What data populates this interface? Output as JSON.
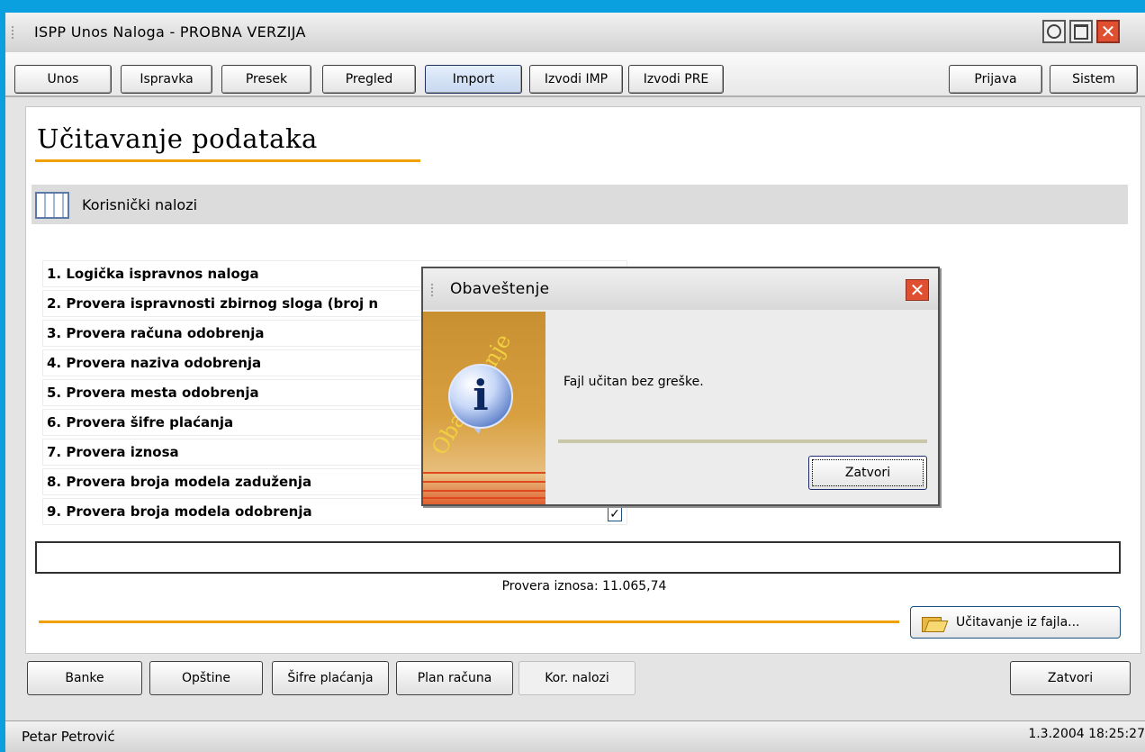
{
  "window": {
    "title": "ISPP Unos Naloga - PROBNA VERZIJA"
  },
  "toolbar": {
    "buttons": [
      "Unos",
      "Ispravka",
      "Presek",
      "Pregled",
      "Import",
      "Izvodi IMP",
      "Izvodi PRE"
    ],
    "right_buttons": [
      "Prijava",
      "Sistem"
    ],
    "active": "Import"
  },
  "page": {
    "title": "Učitavanje podataka",
    "section_title": "Korisnički nalozi",
    "checks": [
      "1. Logička ispravnos naloga",
      "2. Provera ispravnosti zbirnog sloga (broj n",
      "3. Provera računa odobrenja",
      "4. Provera naziva odobrenja",
      "5. Provera mesta odobrenja",
      "6. Provera šifre plaćanja",
      "7. Provera iznosa",
      "8. Provera broja modela zaduženja",
      "9. Provera broja modela odobrenja"
    ],
    "check_mark": "✓",
    "provera_iznosa": "Provera iznosa: 11.065,74",
    "load_button": "Učitavanje iz fajla..."
  },
  "bottom": {
    "buttons": [
      "Banke",
      "Opštine",
      "Šifre plaćanja",
      "Plan računa",
      "Kor. nalozi"
    ],
    "close": "Zatvori"
  },
  "status": {
    "user": "Petar Petrović",
    "datetime": "1.3.2004 18:25:27"
  },
  "dialog": {
    "title": "Obaveštenje",
    "side_text": "Obaveštenje",
    "message": "Fajl učitan bez greške.",
    "button": "Zatvori",
    "icon": "info-icon"
  },
  "colors": {
    "accent_orange": "#f0a000",
    "desktop": "#0aa0e0",
    "close_red": "#e05030"
  }
}
